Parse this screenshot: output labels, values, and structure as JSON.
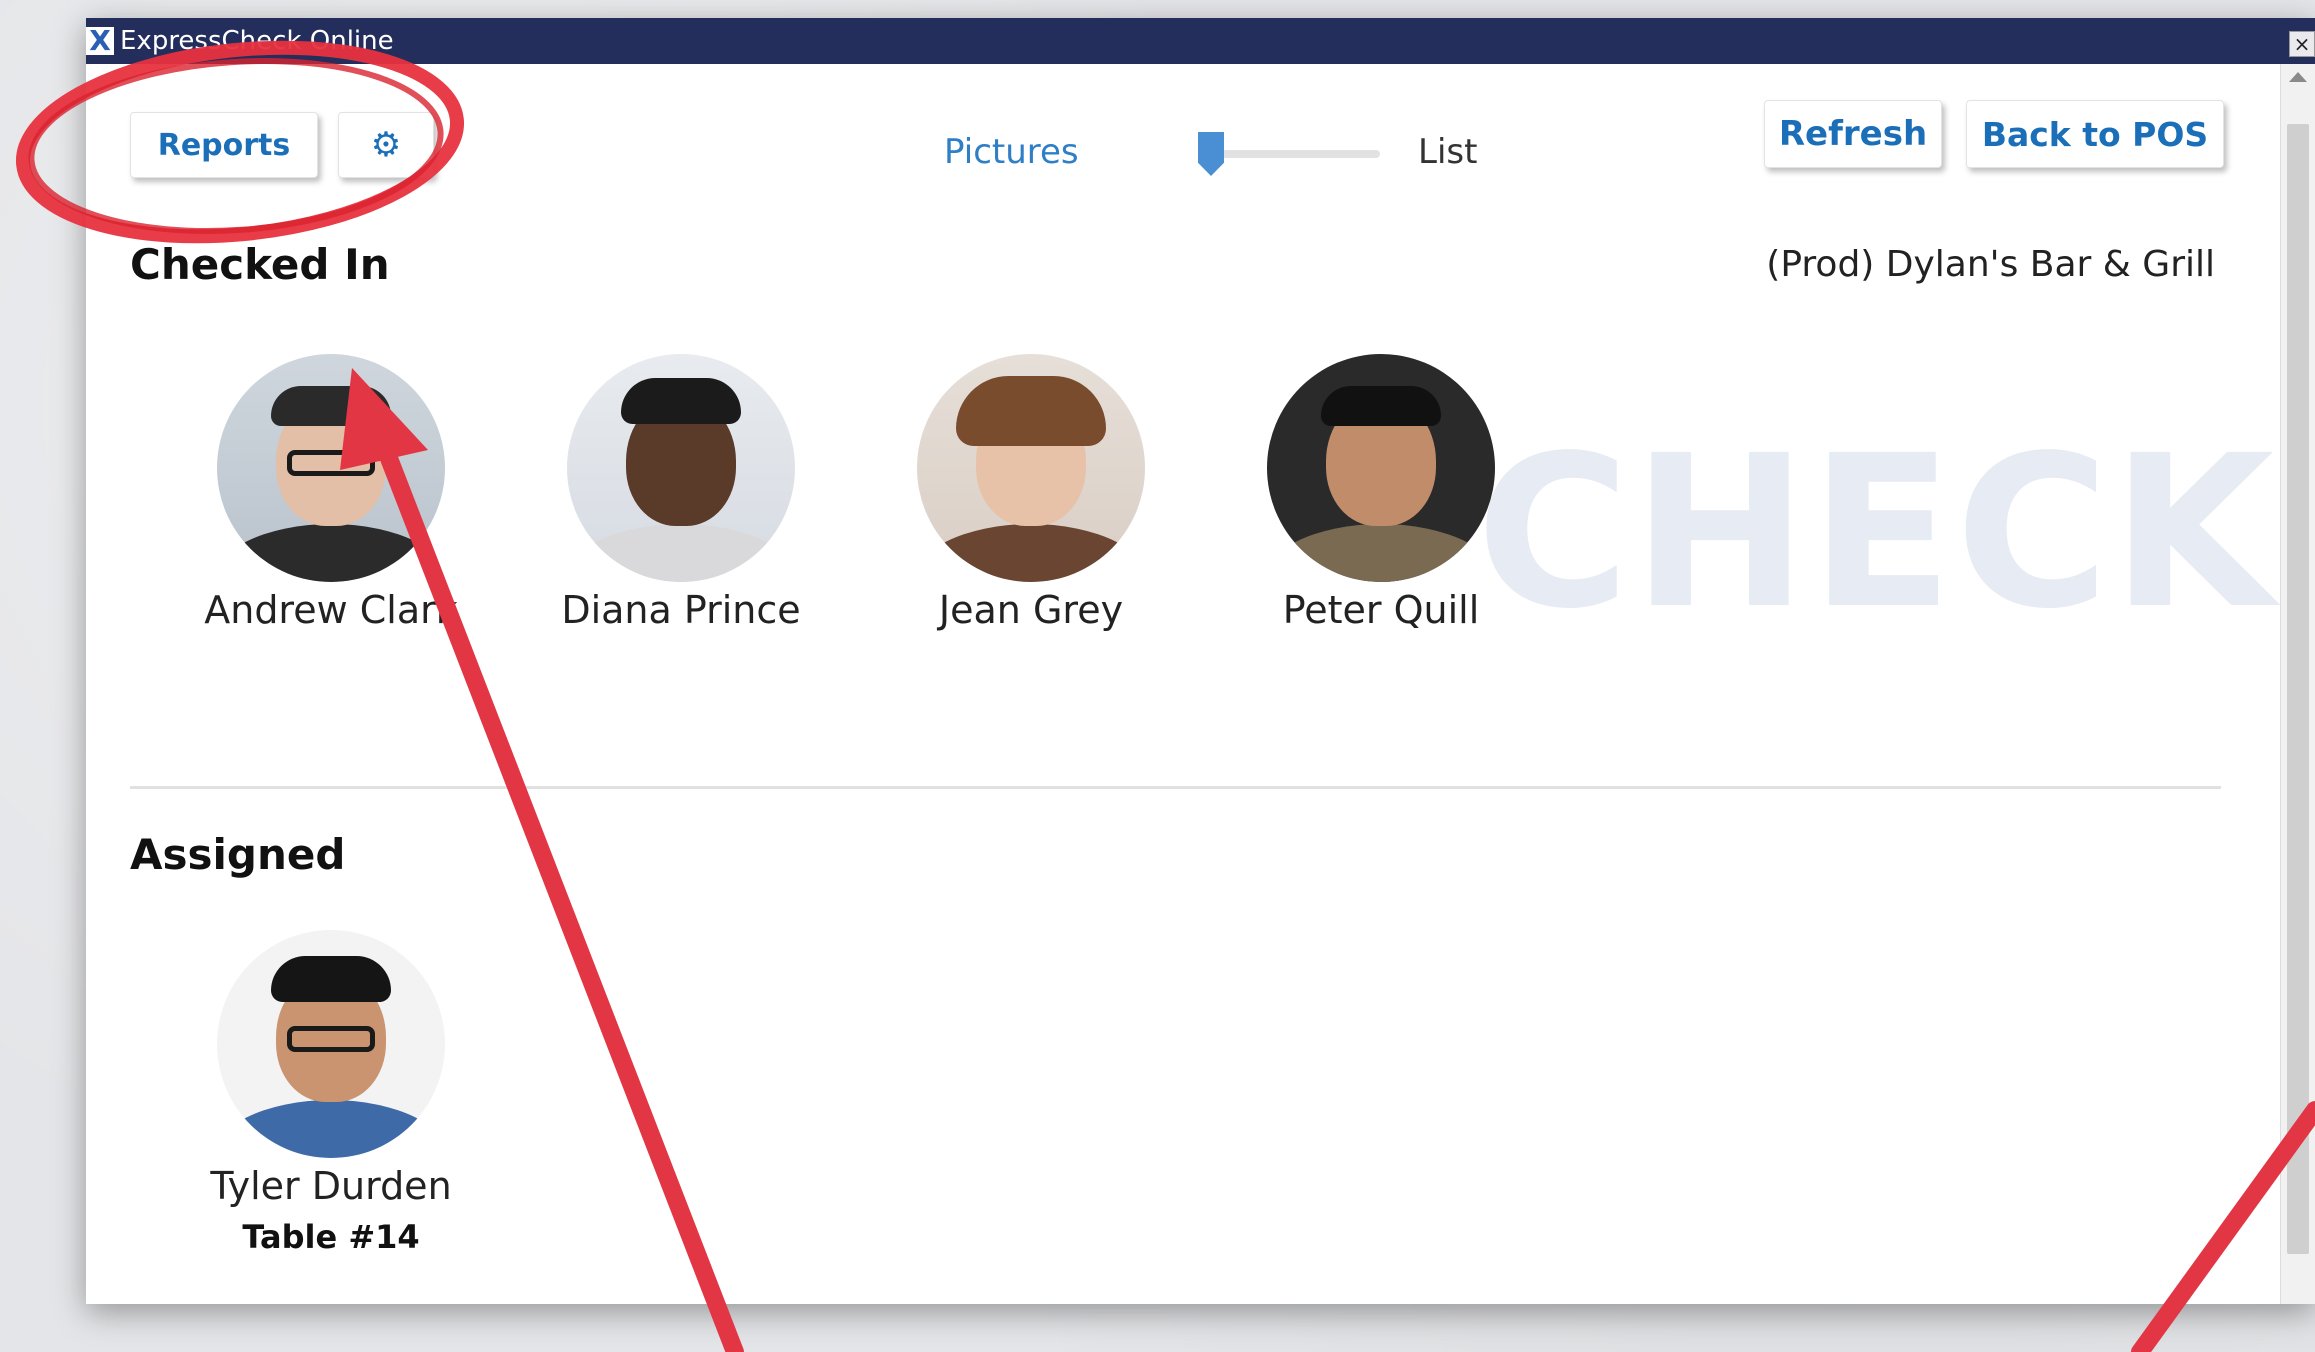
{
  "window": {
    "title": "ExpressCheck Online",
    "app_icon": "X",
    "close_glyph": "×"
  },
  "toolbar": {
    "reports_label": "Reports",
    "settings_label": "⚙",
    "refresh_label": "Refresh",
    "back_to_pos_label": "Back to POS"
  },
  "view_toggle": {
    "left_label": "Pictures",
    "right_label": "List",
    "selected": "Pictures"
  },
  "location": "(Prod) Dylan's Bar & Grill",
  "watermark": "CHECK",
  "sections": {
    "checked_in": {
      "title": "Checked In",
      "people": [
        {
          "name": "Andrew Clark"
        },
        {
          "name": "Diana Prince"
        },
        {
          "name": "Jean Grey"
        },
        {
          "name": "Peter Quill"
        }
      ]
    },
    "assigned": {
      "title": "Assigned",
      "people": [
        {
          "name": "Tyler Durden",
          "table": "Table #14"
        }
      ]
    }
  },
  "colors": {
    "titlebar": "#232e5c",
    "accent_blue": "#1b6fb8",
    "annotation_red": "#e8323f"
  }
}
